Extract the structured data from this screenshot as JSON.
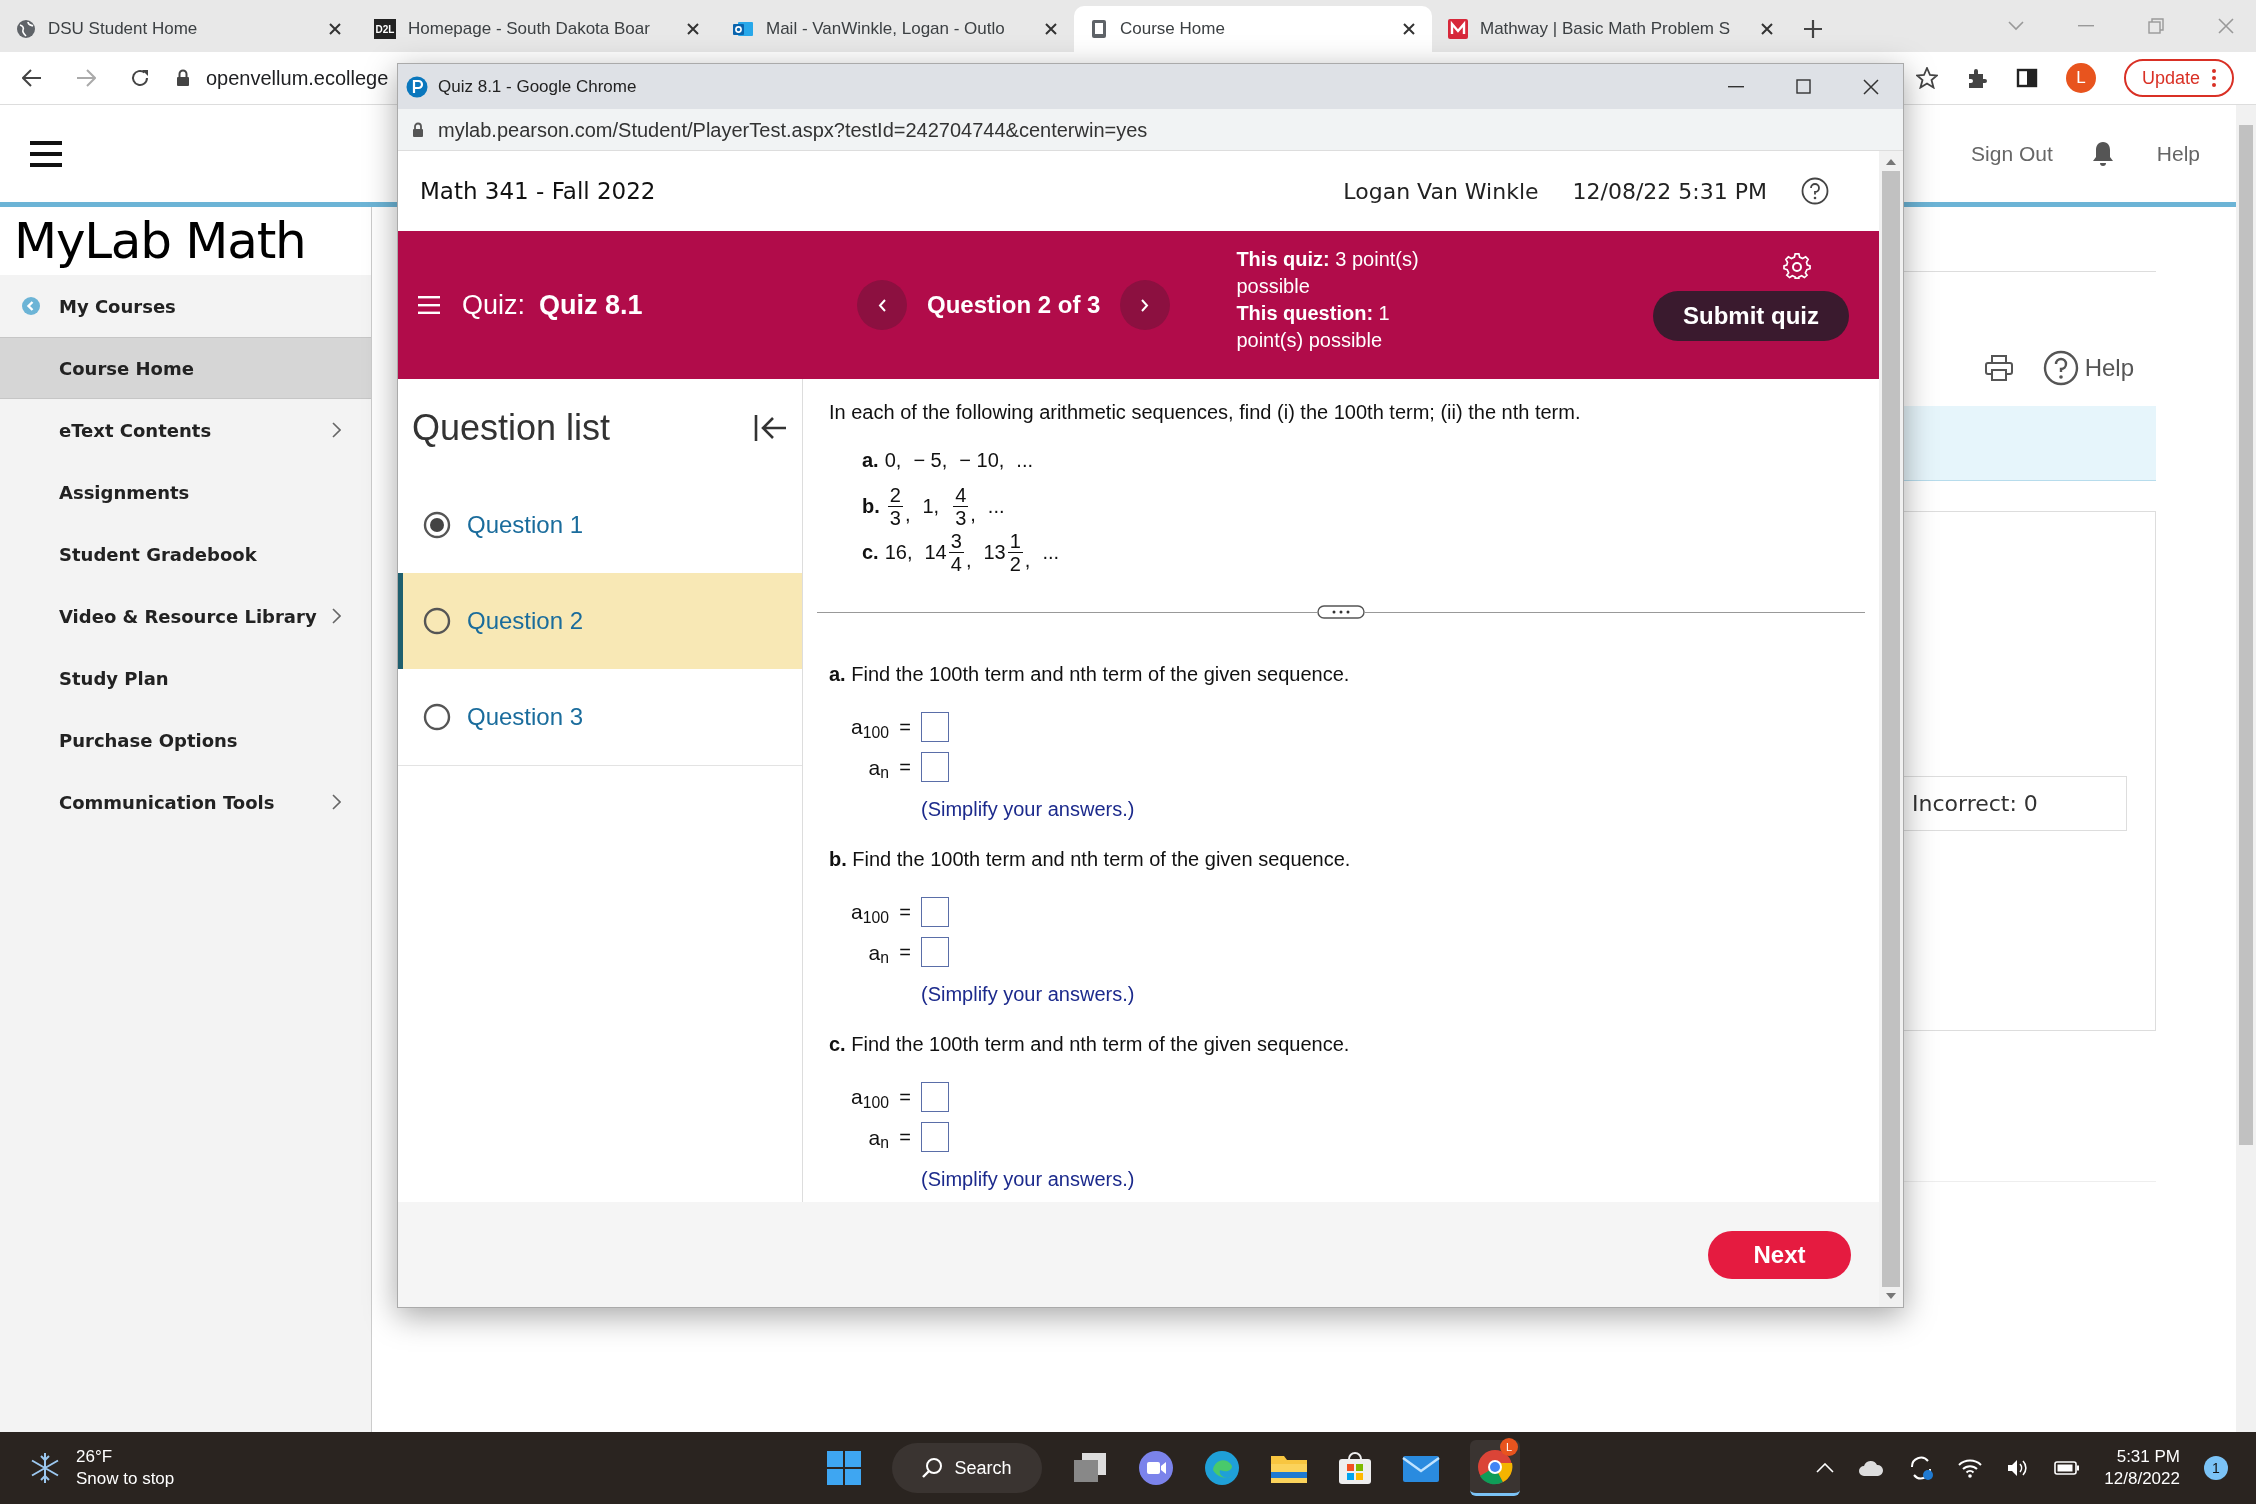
{
  "browser": {
    "tabs": [
      {
        "title": "DSU Student Home",
        "selected": false
      },
      {
        "title": "Homepage - South Dakota Boar",
        "icon_text": "D2L",
        "selected": false
      },
      {
        "title": "Mail - VanWinkle, Logan - Outlo",
        "selected": false
      },
      {
        "title": "Course Home",
        "selected": true
      },
      {
        "title": "Mathway | Basic Math Problem S",
        "selected": false
      }
    ],
    "address": "openvellum.ecollege",
    "profile_initial": "L",
    "update_button": "Update"
  },
  "course_page": {
    "sign_out": "Sign Out",
    "help": "Help",
    "sidebar": {
      "title": "MyLab Math",
      "items": [
        {
          "label": "My Courses",
          "kind": "back",
          "selected": false,
          "submenu": false
        },
        {
          "label": "Course Home",
          "kind": "link",
          "selected": true,
          "submenu": false
        },
        {
          "label": "eText Contents",
          "kind": "link",
          "selected": false,
          "submenu": true
        },
        {
          "label": "Assignments",
          "kind": "link",
          "selected": false,
          "submenu": false
        },
        {
          "label": "Student Gradebook",
          "kind": "link",
          "selected": false,
          "submenu": false
        },
        {
          "label": "Video & Resource Library",
          "kind": "link",
          "selected": false,
          "submenu": true
        },
        {
          "label": "Study Plan",
          "kind": "link",
          "selected": false,
          "submenu": false
        },
        {
          "label": "Purchase Options",
          "kind": "link",
          "selected": false,
          "submenu": false
        },
        {
          "label": "Communication Tools",
          "kind": "link",
          "selected": false,
          "submenu": true
        }
      ]
    },
    "help_link": "Help",
    "score": "Incorrect: 0"
  },
  "quiz_window": {
    "title": "Quiz 8.1 - Google Chrome",
    "url": "mylab.pearson.com/Student/PlayerTest.aspx?testId=242704744&centerwin=yes",
    "course": "Math 341 - Fall 2022",
    "user": "Logan Van Winkle",
    "datetime": "12/08/22 5:31 PM",
    "quiz_label": "Quiz:",
    "quiz_name": "Quiz 8.1",
    "question_position": "Question 2 of 3",
    "points": [
      "**This quiz:** 3 point(s) possible",
      "**This question:** 1 point(s) possible"
    ],
    "submit_button": "Submit quiz",
    "question_list": {
      "title": "Question list",
      "items": [
        {
          "label": "Question 1",
          "selected": false,
          "answered": true
        },
        {
          "label": "Question 2",
          "selected": true,
          "answered": false
        },
        {
          "label": "Question 3",
          "selected": false,
          "answered": false
        }
      ]
    },
    "question": {
      "intro": "In each of the following arithmetic sequences, find (i) the 100th term; (ii) the nth term.",
      "sequences": [
        {
          "label": "a.",
          "terms": [
            {
              "kind": "number",
              "text": "0,"
            },
            {
              "kind": "number",
              "text": "− 5,"
            },
            {
              "kind": "number",
              "text": "− 10,"
            },
            {
              "kind": "number",
              "text": "..."
            }
          ]
        },
        {
          "label": "b.",
          "terms": [
            {
              "kind": "fraction",
              "num": "2",
              "den": "3",
              "after": ","
            },
            {
              "kind": "number",
              "text": "1,"
            },
            {
              "kind": "fraction",
              "num": "4",
              "den": "3",
              "after": ","
            },
            {
              "kind": "number",
              "text": "..."
            }
          ]
        },
        {
          "label": "c.",
          "terms": [
            {
              "kind": "number",
              "text": "16,"
            },
            {
              "kind": "fraction",
              "whole": "14",
              "num": "3",
              "den": "4",
              "after": ","
            },
            {
              "kind": "fraction",
              "whole": "13",
              "num": "1",
              "den": "2",
              "after": ","
            },
            {
              "kind": "number",
              "text": "..."
            }
          ]
        }
      ],
      "parts": [
        {
          "prompt": "**a.** Find the 100th term and nth term of the given sequence.",
          "answers": [
            {
              "label": "a$_{100}$",
              "equals": "="
            },
            {
              "label": "a$_{n}$",
              "equals": "="
            }
          ],
          "hint": "(Simplify your answers.)"
        },
        {
          "prompt": "**b.** Find the 100th term and nth term of the given sequence.",
          "answers": [
            {
              "label": "a$_{100}$",
              "equals": "="
            },
            {
              "label": "a$_{n}$",
              "equals": "="
            }
          ],
          "hint": "(Simplify your answers.)"
        },
        {
          "prompt": "**c.** Find the 100th term and nth term of the given sequence.",
          "answers": [
            {
              "label": "a$_{100}$",
              "equals": "="
            },
            {
              "label": "a$_{n}$",
              "equals": "="
            }
          ],
          "hint": "(Simplify your answers.)"
        }
      ]
    },
    "next_button": "Next"
  },
  "taskbar": {
    "temperature": "26°F",
    "weather": "Snow to stop",
    "search": "Search",
    "chrome_badge": "L",
    "time": "5:31 PM",
    "date": "12/8/2022",
    "notifications": "1"
  }
}
